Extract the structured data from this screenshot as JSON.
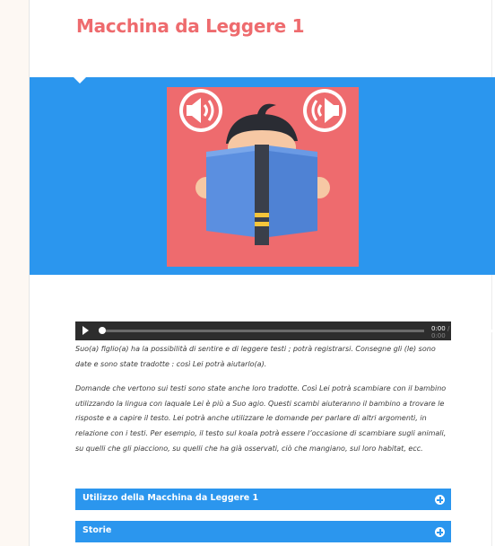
{
  "page": {
    "title": "Macchina da Leggere 1"
  },
  "audio_player": {
    "current_time": "0:00",
    "separator": "/",
    "duration": "0:00",
    "progress": 0,
    "volume": 1.0
  },
  "content": {
    "paragraph_1": "Suo(a) figlio(a) ha la possibilità di sentire e di leggere testi ; potrà registrarsi. Consegne gli (le) sono date e sono state tradotte : così Lei potrà aiutarlo(a).",
    "paragraph_2": "Domande che vertono sui testi sono state anche loro tradotte. Così Lei potrà scambiare con il bambino utilizzando la lingua con laquale Lei è più a Suo agio. Questi scambi aiuteranno il bambino a trovare le risposte e a capire il testo. Lei potrà anche utilizzare le domande per parlare di altri argomenti, in relazione con i testi. Per esempio, il testo sul koala potrà essere l’occasione di scambiare sugli animali, su quelli che gli piacciono, su quelli che ha già osservati, ciò che mangiano, sul loro habitat, ecc."
  },
  "accordion": [
    {
      "label": "Utilizzo della Macchina da Leggere 1"
    },
    {
      "label": "Storie"
    }
  ],
  "colors": {
    "title": "#ee6b6e",
    "banner": "#2b96ee",
    "hero_background": "#ee6b6e",
    "book": "#5b8fe0",
    "player": "#2d2d2d"
  }
}
